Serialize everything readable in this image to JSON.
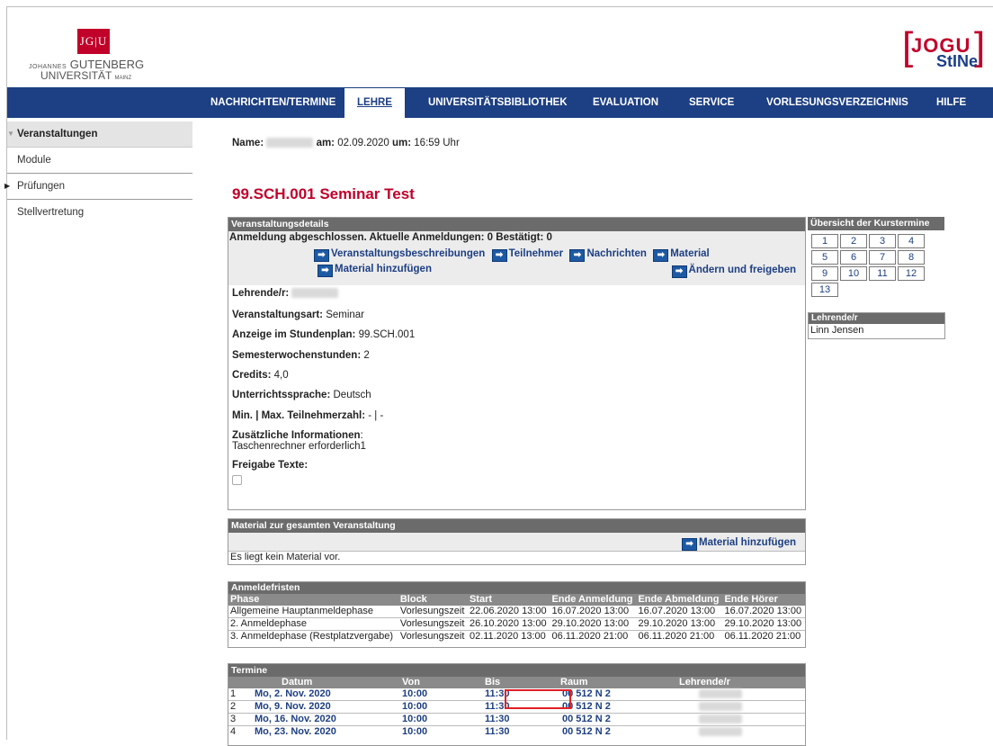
{
  "header": {
    "logo_box": "JG|U",
    "logo_line1_small": "JOHANNES",
    "logo_line1": "GUTENBERG",
    "logo_line2": "UNIVERSITÄT",
    "logo_line2_small": "MAINZ",
    "brand_top": "JOGU",
    "brand_bottom": "StINe"
  },
  "nav": {
    "items": [
      "NACHRICHTEN/TERMINE",
      "LEHRE",
      "UNIVERSITÄTSBIBLIOTHEK",
      "EVALUATION",
      "SERVICE",
      "VORLESUNGSVERZEICHNIS",
      "HILFE"
    ],
    "active": "LEHRE"
  },
  "sidebar": {
    "items": [
      "Veranstaltungen",
      "Module",
      "Prüfungen",
      "Stellvertretung"
    ]
  },
  "meta": {
    "name_label": "Name:",
    "am_label": "am:",
    "date": "02.09.2020",
    "um_label": "um:",
    "time": "16:59 Uhr"
  },
  "title": "99.SCH.001 Seminar Test",
  "details": {
    "head": "Veranstaltungsdetails",
    "status": "Anmeldung abgeschlossen.  Aktuelle Anmeldungen: 0  Bestätigt: 0",
    "buttons": [
      "Veranstaltungsbeschreibungen",
      "Teilnehmer",
      "Nachrichten",
      "Material",
      "Material hinzufügen",
      "Ändern und freigeben"
    ],
    "lehrende_label": "Lehrende/r:",
    "art_label": "Veranstaltungsart:",
    "art_value": "Seminar",
    "anzeige_label": "Anzeige im Stundenplan:",
    "anzeige_value": "99.SCH.001",
    "sws_label": "Semesterwochenstunden:",
    "sws_value": "2",
    "credits_label": "Credits:",
    "credits_value": "4,0",
    "sprache_label": "Unterrichtssprache:",
    "sprache_value": "Deutsch",
    "teiln_label": "Min. | Max. Teilnehmerzahl:",
    "teiln_value": "- | -",
    "zusatz_label": "Zusätzliche Informationen",
    "zusatz_colon": ":",
    "zusatz_value": "Taschenrechner erforderlich1",
    "freigabe_label": "Freigabe Texte:"
  },
  "kurstermine": {
    "head": "Übersicht der Kurstermine",
    "numbers": [
      "1",
      "2",
      "3",
      "4",
      "5",
      "6",
      "7",
      "8",
      "9",
      "10",
      "11",
      "12",
      "13"
    ]
  },
  "lehrende_box": {
    "head": "Lehrende/r",
    "name": "Linn Jensen"
  },
  "material": {
    "head": "Material zur gesamten Veranstaltung",
    "button": "Material hinzufügen",
    "empty": "Es liegt kein Material vor."
  },
  "fristen": {
    "head": "Anmeldefristen",
    "columns": [
      "Phase",
      "Block",
      "Start",
      "Ende Anmeldung",
      "Ende Abmeldung",
      "Ende Hörer"
    ],
    "rows": [
      [
        "Allgemeine Hauptanmeldephase",
        "Vorlesungszeit",
        "22.06.2020 13:00",
        "16.07.2020 13:00",
        "16.07.2020 13:00",
        "16.07.2020 13:00"
      ],
      [
        "2. Anmeldephase",
        "Vorlesungszeit",
        "26.10.2020 13:00",
        "29.10.2020 13:00",
        "29.10.2020 13:00",
        "29.10.2020 13:00"
      ],
      [
        "3. Anmeldephase (Restplatzvergabe)",
        "Vorlesungszeit",
        "02.11.2020 13:00",
        "06.11.2020 21:00",
        "06.11.2020 21:00",
        "06.11.2020 21:00"
      ]
    ]
  },
  "termine": {
    "head": "Termine",
    "columns": [
      "",
      "Datum",
      "Von",
      "Bis",
      "Raum",
      "Lehrende/r"
    ],
    "rows": [
      [
        "1",
        "Mo, 2. Nov. 2020",
        "10:00",
        "11:30",
        "00 512 N 2"
      ],
      [
        "2",
        "Mo, 9. Nov. 2020",
        "10:00",
        "11:30",
        "00 512 N 2"
      ],
      [
        "3",
        "Mo, 16. Nov. 2020",
        "10:00",
        "11:30",
        "00 512 N 2"
      ],
      [
        "4",
        "Mo, 23. Nov. 2020",
        "10:00",
        "11:30",
        "00 512 N 2"
      ]
    ]
  },
  "colors": {
    "nav_bg": "#1d3f83",
    "title_red": "#c1002a",
    "box_head": "#6b6b6b",
    "highlight": "#e21f26"
  }
}
